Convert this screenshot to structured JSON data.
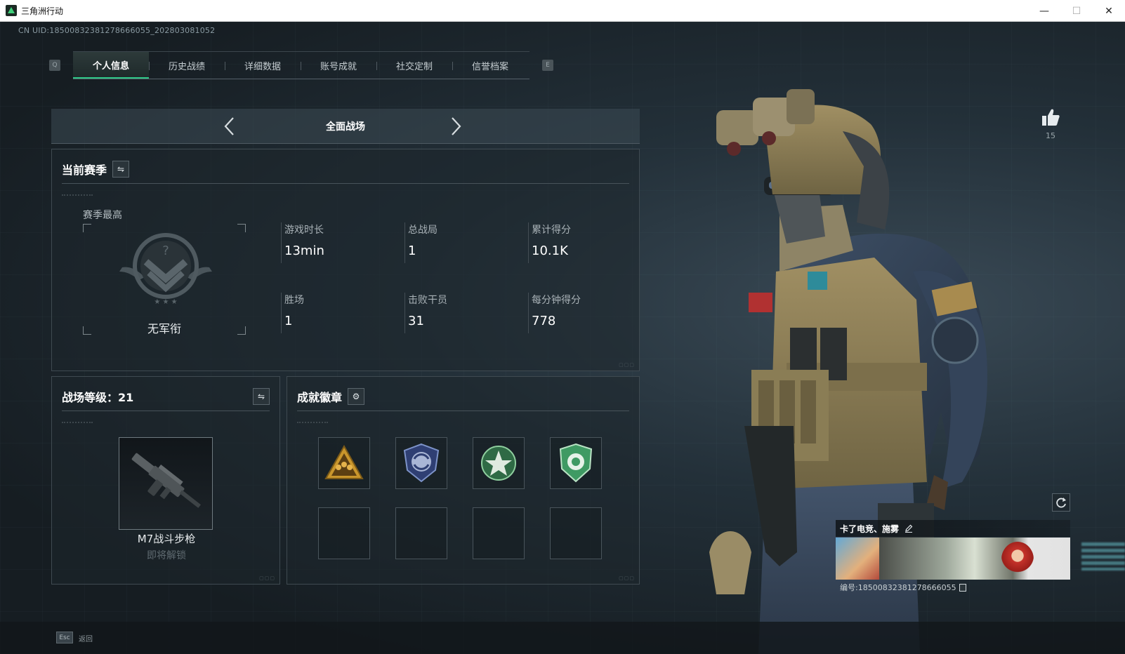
{
  "window": {
    "title": "三角洲行动",
    "minimize": "—",
    "maximize": "☐",
    "close": "✕"
  },
  "uid_text": "CN UID:18500832381278666055_202803081052",
  "tabs": {
    "prev_key": "Q",
    "next_key": "E",
    "items": [
      {
        "label": "个人信息",
        "active": true
      },
      {
        "label": "历史战绩"
      },
      {
        "label": "详细数据"
      },
      {
        "label": "账号成就"
      },
      {
        "label": "社交定制"
      },
      {
        "label": "信誉档案"
      }
    ]
  },
  "mode": {
    "label": "全面战场"
  },
  "season": {
    "title": "当前赛季",
    "best_label": "赛季最高",
    "rank_name": "无军衔",
    "stats": [
      {
        "label": "游戏时长",
        "value": "13min"
      },
      {
        "label": "总战局",
        "value": "1"
      },
      {
        "label": "累计得分",
        "value": "10.1K"
      },
      {
        "label": "胜场",
        "value": "1"
      },
      {
        "label": "击败干员",
        "value": "31"
      },
      {
        "label": "每分钟得分",
        "value": "778"
      }
    ]
  },
  "level": {
    "title": "战场等级：21",
    "weapon_name": "M7战斗步枪",
    "weapon_status": "即将解锁"
  },
  "badges": {
    "title": "成就徽章",
    "slots": [
      {
        "icon": "triangle-squad-badge-icon",
        "color": "#c9962c"
      },
      {
        "icon": "shield-arrows-badge-icon",
        "color": "#5b74b8"
      },
      {
        "icon": "star-wreath-badge-icon",
        "color": "#3c8b5a"
      },
      {
        "icon": "shield-emblem-badge-icon",
        "color": "#3f9a63"
      },
      {
        "icon": ""
      },
      {
        "icon": ""
      },
      {
        "icon": ""
      },
      {
        "icon": ""
      }
    ]
  },
  "like": {
    "count": "15"
  },
  "card": {
    "name": "卡了电竞、施雾",
    "id_text": "编号:18500832381278666055"
  },
  "bottom": {
    "esc_key": "Esc",
    "esc_label": "返回"
  },
  "colors": {
    "accent_green": "#2ec787",
    "panel_border": "#3f4a51",
    "background": "#1a2127"
  }
}
